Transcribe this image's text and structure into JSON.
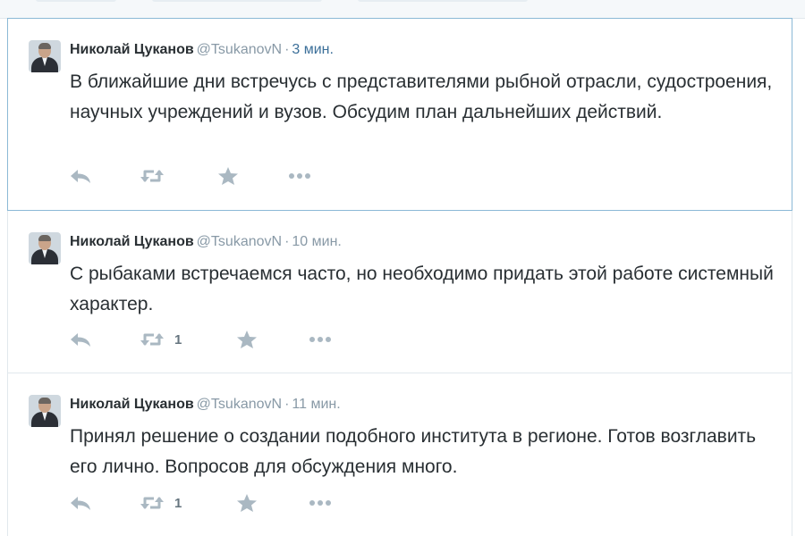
{
  "tweets": [
    {
      "name": "Николай Цуканов",
      "screen_name": "@TsukanovN",
      "separator": "·",
      "time": "3 мин.",
      "time_accent": true,
      "text": "В ближайшие дни встречусь с представителями рыбной отрасли, судостроения, научных учреждений и вузов. Обсудим план дальнейших действий.",
      "retweet_count": ""
    },
    {
      "name": "Николай Цуканов",
      "screen_name": "@TsukanovN",
      "separator": "·",
      "time": "10 мин.",
      "time_accent": false,
      "text": "С рыбаками встречаемся часто, но необходимо придать этой работе системный характер.",
      "retweet_count": "1"
    },
    {
      "name": "Николай Цуканов",
      "screen_name": "@TsukanovN",
      "separator": "·",
      "time": "11 мин.",
      "time_accent": false,
      "text": "Принял решение о создании подобного института в регионе. Готов возглавить его лично. Вопросов для обсуждения много.",
      "retweet_count": "1"
    }
  ],
  "icons": {
    "reply": "reply-icon",
    "retweet": "retweet-icon",
    "favorite": "star-icon",
    "more": "more-icon",
    "avatar": "avatar-photo"
  },
  "colors": {
    "name": "#292f33",
    "muted": "#8899a6",
    "time_accent": "#3b6f99",
    "action_icon": "#aab8c2",
    "highlight_border": "#8bb9d6",
    "divider": "#e1e8ed"
  }
}
